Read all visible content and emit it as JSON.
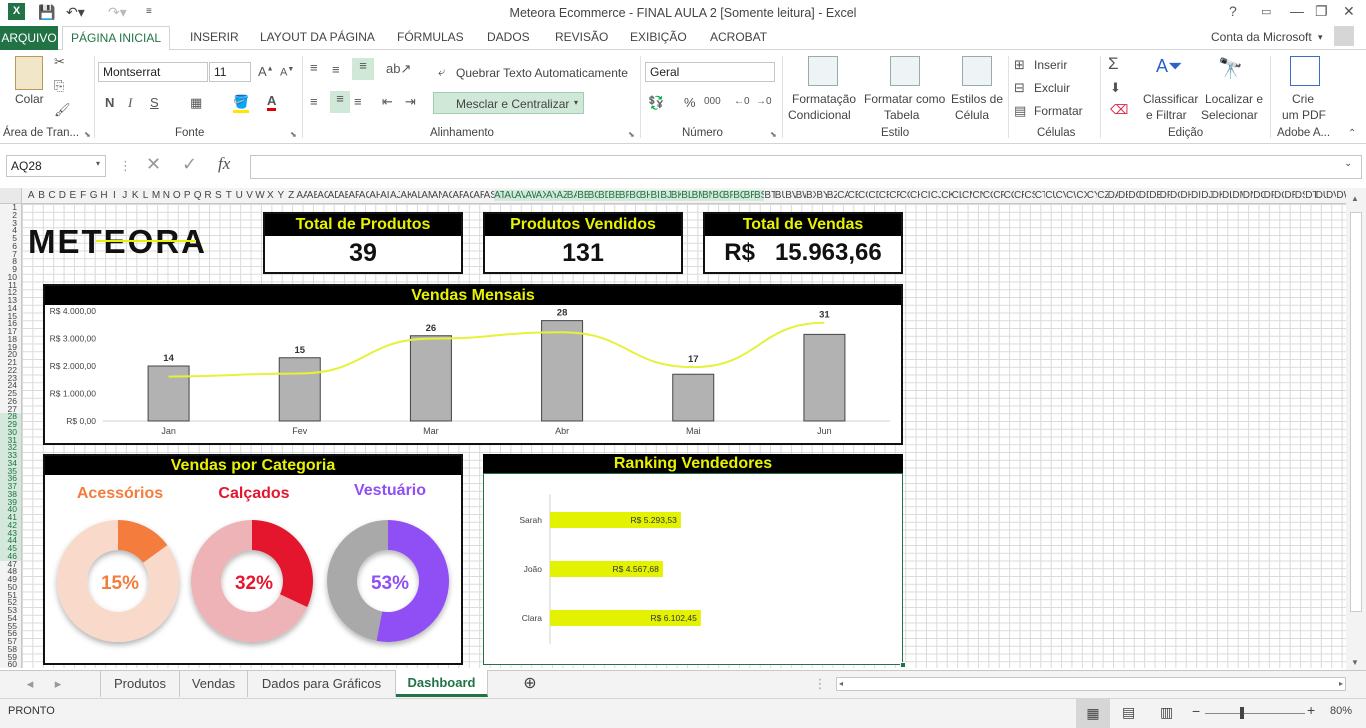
{
  "window": {
    "title": "Meteora Ecommerce - FINAL AULA 2  [Somente leitura] - Excel",
    "help": "?",
    "minimize": "—",
    "restore": "❐",
    "close": "✕"
  },
  "tabs": {
    "file": "ARQUIVO",
    "home": "PÁGINA INICIAL",
    "insert": "INSERIR",
    "layout": "LAYOUT DA PÁGINA",
    "formulas": "FÓRMULAS",
    "data": "DADOS",
    "review": "REVISÃO",
    "view": "EXIBIÇÃO",
    "acrobat": "ACROBAT",
    "account": "Conta da Microsoft"
  },
  "ribbon": {
    "clipboard": {
      "paste": "Colar",
      "group": "Área de Tran..."
    },
    "font": {
      "name": "Montserrat",
      "size": "11",
      "bold": "N",
      "italic": "I",
      "underline": "S",
      "group": "Fonte"
    },
    "alignment": {
      "wrap": "Quebrar Texto Automaticamente",
      "merge": "Mesclar e Centralizar",
      "group": "Alinhamento"
    },
    "number": {
      "format": "Geral",
      "percent": "%",
      "thousands": "000",
      "group": "Número"
    },
    "styles": {
      "conditional_1": "Formatação",
      "conditional_2": "Condicional",
      "table_1": "Formatar como",
      "table_2": "Tabela",
      "cell_1": "Estilos de",
      "cell_2": "Célula",
      "group": "Estilo"
    },
    "cells": {
      "insert": "Inserir",
      "delete": "Excluir",
      "format": "Formatar",
      "group": "Células"
    },
    "editing": {
      "sort_1": "Classificar",
      "sort_2": "e Filtrar",
      "find_1": "Localizar e",
      "find_2": "Selecionar",
      "group": "Edição"
    },
    "adobe": {
      "pdf_1": "Crie",
      "pdf_2": "um PDF",
      "group": "Adobe A..."
    }
  },
  "formula_bar": {
    "name_box": "AQ28",
    "fx": "fx",
    "content": ""
  },
  "dashboard": {
    "logo": "METEORA",
    "kpis": [
      {
        "label": "Total de Produtos",
        "value": "39"
      },
      {
        "label": "Produtos Vendidos",
        "value": "131"
      },
      {
        "label": "Total de Vendas",
        "currency": "R$",
        "value": "15.963,66"
      }
    ],
    "panel_titles": {
      "monthly": "Vendas Mensais",
      "category": "Vendas por Categoria",
      "ranking": "Ranking Vendedores"
    }
  },
  "chart_data": [
    {
      "type": "bar",
      "title": "Vendas Mensais",
      "categories": [
        "Jan",
        "Fev",
        "Mar",
        "Abr",
        "Mai",
        "Jun"
      ],
      "series": [
        {
          "values": [
            2000,
            2300,
            3100,
            3650,
            1700,
            3150
          ]
        },
        {
          "type": "line",
          "values": [
            14,
            15,
            26,
            28,
            17,
            31
          ]
        }
      ],
      "data_labels": [
        "14",
        "15",
        "26",
        "28",
        "17",
        "31"
      ],
      "y_ticks": [
        "R$ 0,00",
        "R$ 1.000,00",
        "R$ 2.000,00",
        "R$ 3.000,00",
        "R$ 4.000,00"
      ],
      "ylim": [
        0,
        4000
      ],
      "colors": {
        "bar": "#b2b2b2",
        "line": "#e6f23a"
      }
    },
    {
      "type": "pie",
      "title": "Vendas por Categoria",
      "categories": [
        "Acessórios",
        "Calçados",
        "Vestuário"
      ],
      "values": [
        15,
        32,
        53
      ],
      "labels": [
        "15%",
        "32%",
        "53%"
      ],
      "colors": [
        "#f47c3c",
        "#e3172d",
        "#8f4ff5"
      ],
      "rest_colors": [
        "#f9d9c9",
        "#edb3b7",
        "#a9a9a9"
      ]
    },
    {
      "type": "bar",
      "orientation": "horizontal",
      "title": "Ranking Vendedores",
      "categories": [
        "Sarah",
        "João",
        "Clara"
      ],
      "values": [
        5293.53,
        4567.68,
        6102.45
      ],
      "labels": [
        "R$ 5.293,53",
        "R$ 4.567,68",
        "R$ 6.102,45"
      ],
      "xlim": [
        0,
        14000
      ],
      "colors": {
        "bar": "#e2f200"
      }
    }
  ],
  "sheets": [
    {
      "name": "Produtos",
      "active": false
    },
    {
      "name": "Vendas",
      "active": false
    },
    {
      "name": "Dados para Gráficos",
      "active": false
    },
    {
      "name": "Dashboard",
      "active": true
    }
  ],
  "status": {
    "ready": "PRONTO",
    "zoom": "80%"
  }
}
